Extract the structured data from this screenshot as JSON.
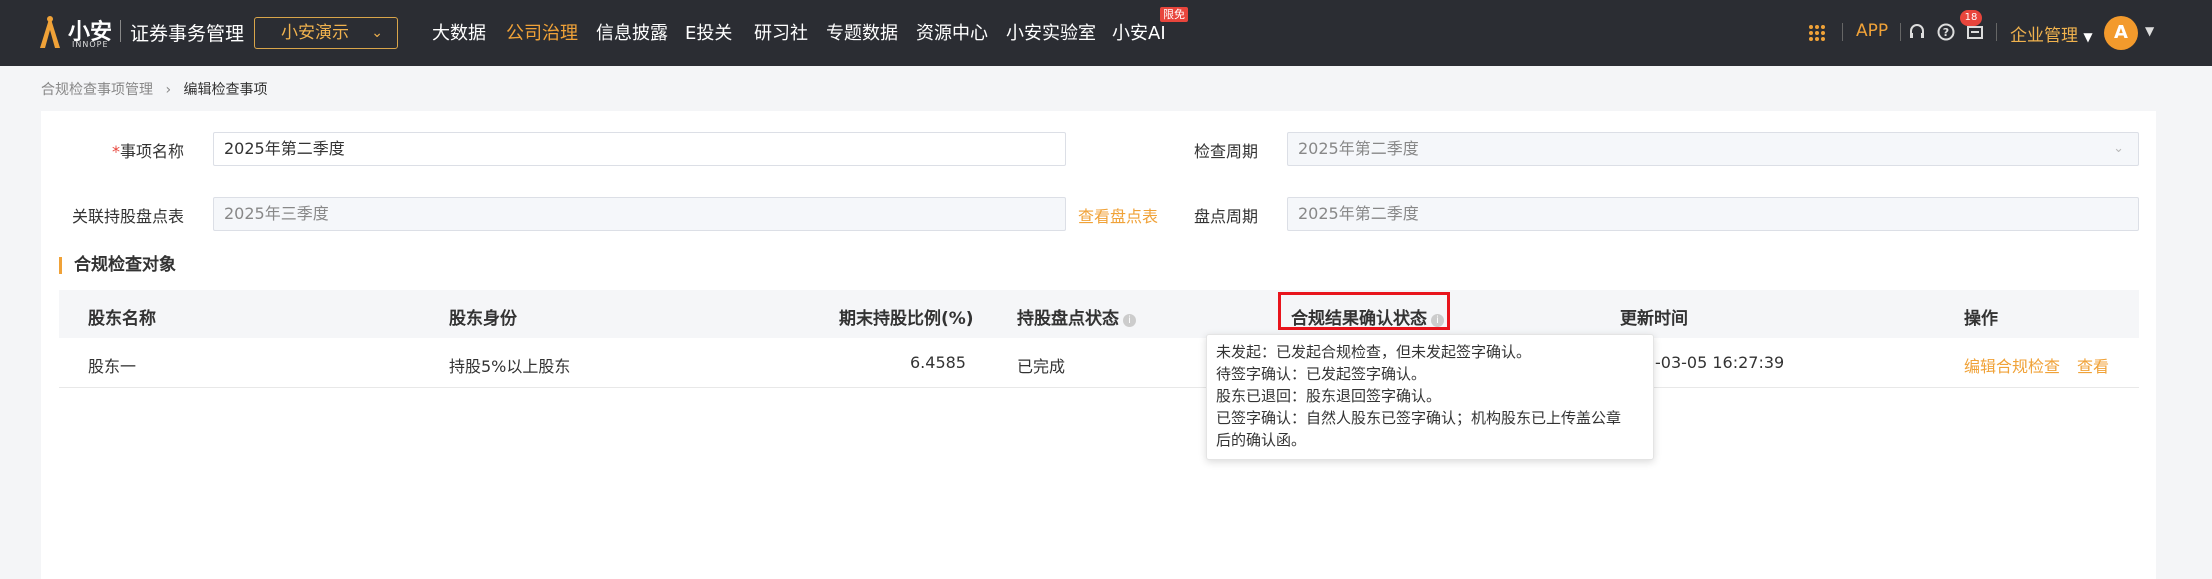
{
  "header": {
    "brand": "小安",
    "brand_sub": "INNOPE",
    "title": "证券事务管理",
    "org_select": "小安演示",
    "nav": [
      "大数据",
      "公司治理",
      "信息披露",
      "E投关",
      "研习社",
      "专题数据",
      "资源中心",
      "小安实验室",
      "小安AI"
    ],
    "nav_active": "公司治理",
    "nav_badge": "限免",
    "app_label": "APP",
    "notice_count": "18",
    "company_menu": "企业管理",
    "avatar_letter": "A"
  },
  "breadcrumb": {
    "parent": "合规检查事项管理",
    "current": "编辑检查事项"
  },
  "form": {
    "name_label": "事项名称",
    "name_value": "2025年第二季度",
    "period_label": "检查周期",
    "period_value": "2025年第二季度",
    "holding_label": "关联持股盘点表",
    "holding_value": "2025年三季度",
    "view_link": "查看盘点表",
    "count_period_label": "盘点周期",
    "count_period_value": "2025年第二季度"
  },
  "section_title": "合规检查对象",
  "table": {
    "headers": [
      "股东名称",
      "股东身份",
      "期末持股比例(%)",
      "持股盘点状态",
      "合规结果确认状态",
      "更新时间",
      "操作"
    ],
    "rows": [
      {
        "name": "股东一",
        "identity": "持股5%以上股东",
        "ratio": "6.4585",
        "count_status": "已完成",
        "update_time": "-03-05 16:27:39",
        "action_edit": "编辑合规检查",
        "action_view": "查看"
      }
    ]
  },
  "tooltip": {
    "lines": [
      "未发起：已发起合规检查，但未发起签字确认。",
      "待签字确认：已发起签字确认。",
      "股东已退回：股东退回签字确认。",
      "已签字确认：自然人股东已签字确认；机构股东已上传盖公章",
      "后的确认函。"
    ]
  }
}
